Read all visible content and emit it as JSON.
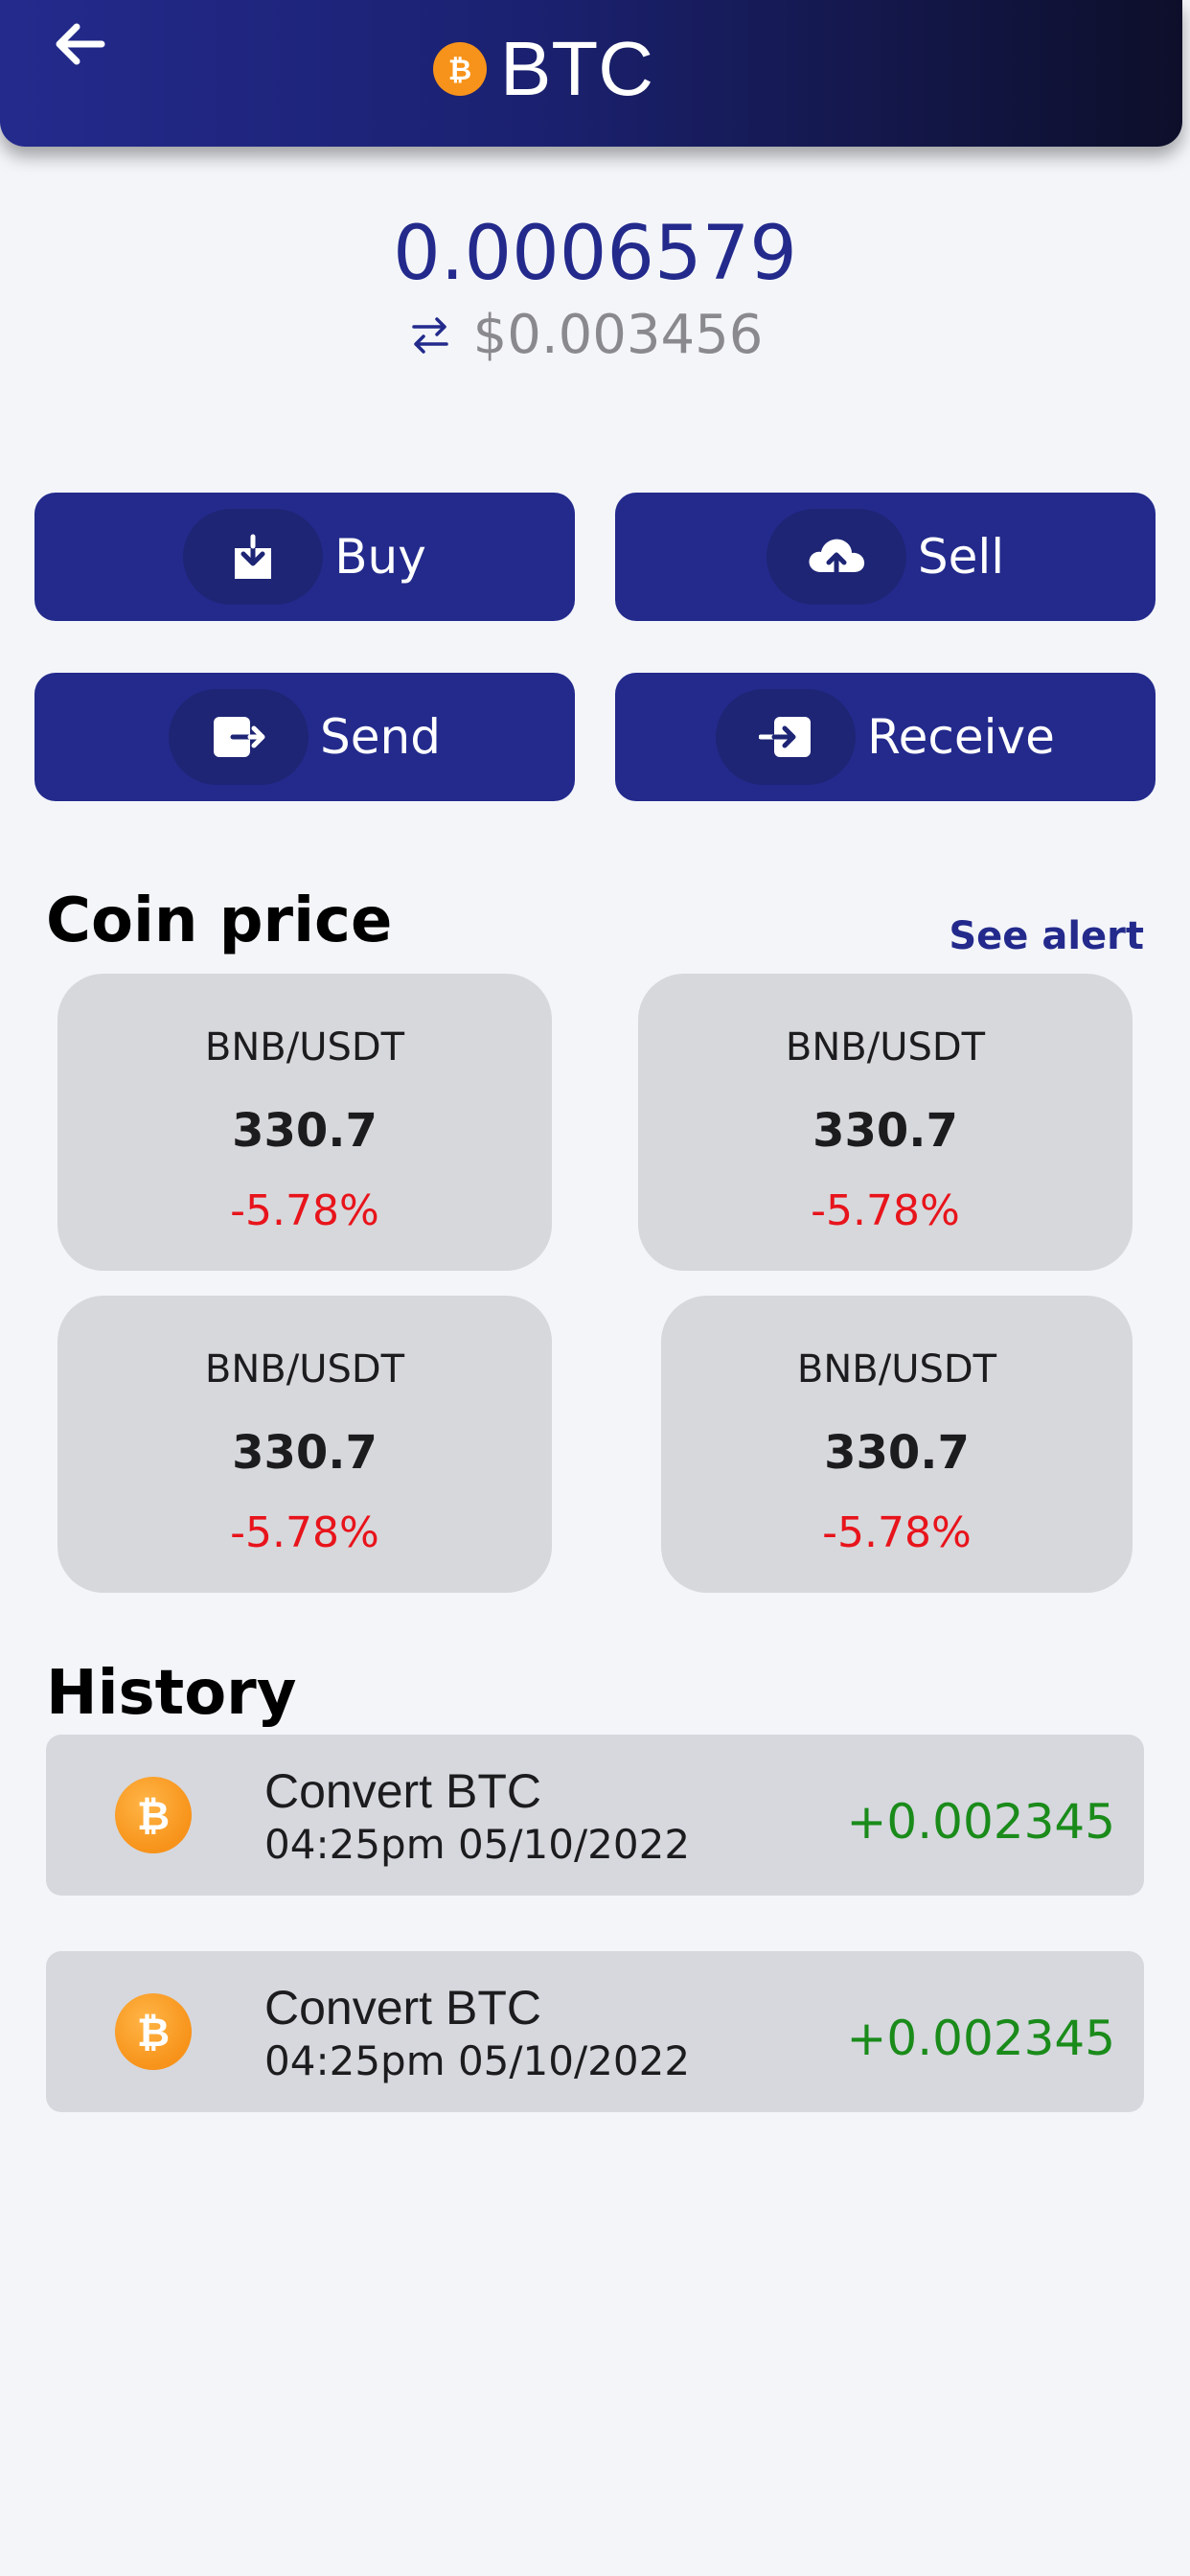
{
  "header": {
    "title": "BTC",
    "back_icon": "arrow-left-icon",
    "coin_icon": "bitcoin-icon"
  },
  "balance": {
    "amount": "0.0006579",
    "fiat": "$0.003456",
    "swap_icon": "swap-arrows-icon"
  },
  "actions": [
    {
      "label": "Buy",
      "icon": "download-box-icon"
    },
    {
      "label": "Sell",
      "icon": "cloud-upload-icon"
    },
    {
      "label": "Send",
      "icon": "exit-door-icon"
    },
    {
      "label": "Receive",
      "icon": "login-arrow-icon"
    }
  ],
  "coin_price": {
    "title": "Coin price",
    "see_alert": "See alert",
    "cards": [
      {
        "pair": "BNB/USDT",
        "price": "330.7",
        "change": "-5.78%"
      },
      {
        "pair": "BNB/USDT",
        "price": "330.7",
        "change": "-5.78%"
      },
      {
        "pair": "BNB/USDT",
        "price": "330.7",
        "change": "-5.78%"
      },
      {
        "pair": "BNB/USDT",
        "price": "330.7",
        "change": "-5.78%"
      }
    ]
  },
  "history": {
    "title": "History",
    "items": [
      {
        "title": "Convert BTC",
        "date": "04:25pm 05/10/2022",
        "amount": "+0.002345",
        "icon": "bitcoin-icon"
      },
      {
        "title": "Convert BTC",
        "date": "04:25pm 05/10/2022",
        "amount": "+0.002345",
        "icon": "bitcoin-icon"
      }
    ]
  },
  "colors": {
    "primary": "#232a8c",
    "negative": "#e8141b",
    "positive": "#1a8b1a",
    "bitcoin": "#f7931a"
  }
}
